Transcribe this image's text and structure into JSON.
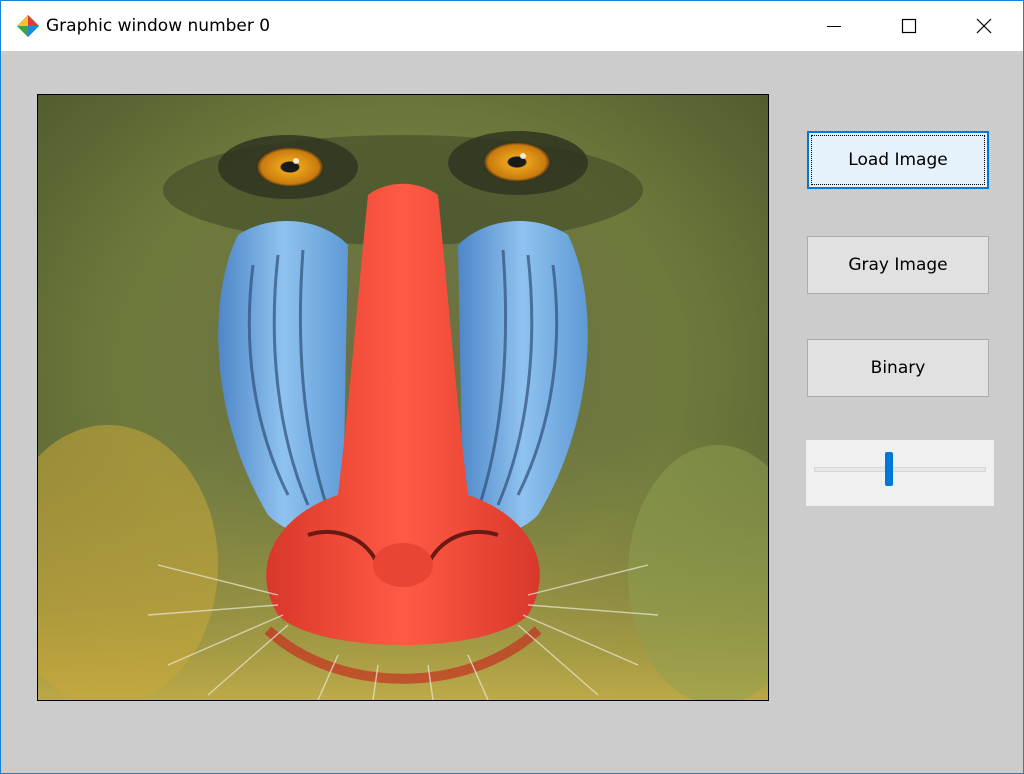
{
  "window": {
    "title": "Graphic window number 0",
    "app_icon": "scilab-diamond-icon",
    "controls": {
      "minimize_icon": "minimize-icon",
      "maximize_icon": "maximize-icon",
      "close_icon": "close-icon"
    }
  },
  "image": {
    "subject": "mandrill",
    "alt": "Mandrill"
  },
  "buttons": {
    "load_label": "Load Image",
    "gray_label": "Gray Image",
    "binary_label": "Binary"
  },
  "slider": {
    "value_fraction": 0.44
  },
  "colors": {
    "window_border": "#1883d7",
    "client_bg": "#cccccc",
    "accent": "#0078d7",
    "button_bg": "#e1e1e1",
    "focused_button_bg": "#e5f1fb"
  }
}
